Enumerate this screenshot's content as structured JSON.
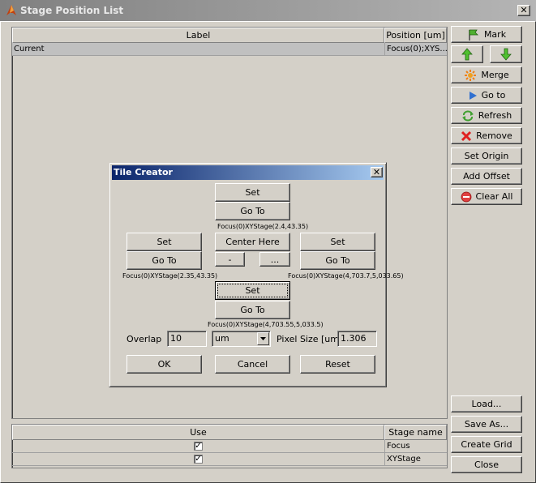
{
  "window": {
    "title": "Stage Position List"
  },
  "positions_table": {
    "columns": [
      "Label",
      "Position [um]"
    ],
    "rows": [
      {
        "label": "Current",
        "position": "Focus(0);XYS..."
      }
    ]
  },
  "side_buttons": {
    "mark": "Mark",
    "merge": "Merge",
    "goto": "Go to",
    "refresh": "Refresh",
    "remove": "Remove",
    "set_origin": "Set Origin",
    "add_offset": "Add Offset",
    "clear_all": "Clear All",
    "load": "Load...",
    "save_as": "Save As...",
    "create_grid": "Create Grid",
    "close": "Close"
  },
  "stages_table": {
    "columns": [
      "Use",
      "Stage name"
    ],
    "rows": [
      {
        "use": true,
        "name": "Focus"
      },
      {
        "use": true,
        "name": "XYStage"
      }
    ]
  },
  "dialog": {
    "title": "Tile Creator",
    "top": {
      "set": "Set",
      "goto": "Go To",
      "coord": "Focus(0)XYStage(2.4,43.35)"
    },
    "left": {
      "set": "Set",
      "goto": "Go To",
      "coord": "Focus(0)XYStage(2.35,43.35)"
    },
    "center": {
      "center_here": "Center Here",
      "minus": "-",
      "more": "..."
    },
    "right": {
      "set": "Set",
      "goto": "Go To",
      "coord": "Focus(0)XYStage(4,703.7,5,033.65)"
    },
    "bottom": {
      "set": "Set",
      "goto": "Go To",
      "coord": "Focus(0)XYStage(4,703.55,5,033.5)"
    },
    "overlap_label": "Overlap",
    "overlap_value": "10",
    "unit_value": "um",
    "pixel_size_label": "Pixel Size [um]",
    "pixel_size_value": "1.306",
    "ok": "OK",
    "cancel": "Cancel",
    "reset": "Reset"
  },
  "colors": {
    "background": "#d4d0c8",
    "dialog_title_start": "#0a246a",
    "dialog_title_end": "#a6caf0",
    "inactive_title": "#808080"
  }
}
